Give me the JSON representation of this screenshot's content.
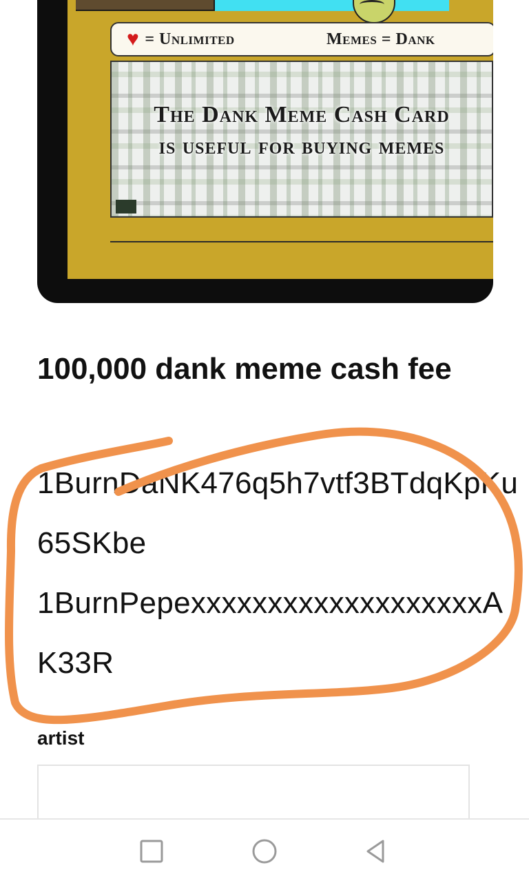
{
  "card": {
    "stat_left": "= Unlimited",
    "stat_right": "Memes = Dank",
    "panel_text": "The Dank Meme Cash Card is useful for buying memes",
    "colors": {
      "frame": "#0d0d0d",
      "gold": "#c9a62a",
      "heart": "#d41b1b",
      "cyan": "#41e0f2"
    }
  },
  "content": {
    "title": "100,000 dank meme cash fee",
    "address_1": "1BurnDaNK476q5h7vtf3BTdqKpKu65SKbe",
    "address_2": "1BurnPepexxxxxxxxxxxxxxxxxxxAK33R",
    "artist_label": "artist",
    "artist_value": ""
  },
  "annotation": {
    "color": "#f0924c"
  },
  "navbar": {
    "recents_icon": "square-icon",
    "home_icon": "circle-icon",
    "back_icon": "triangle-back-icon"
  }
}
